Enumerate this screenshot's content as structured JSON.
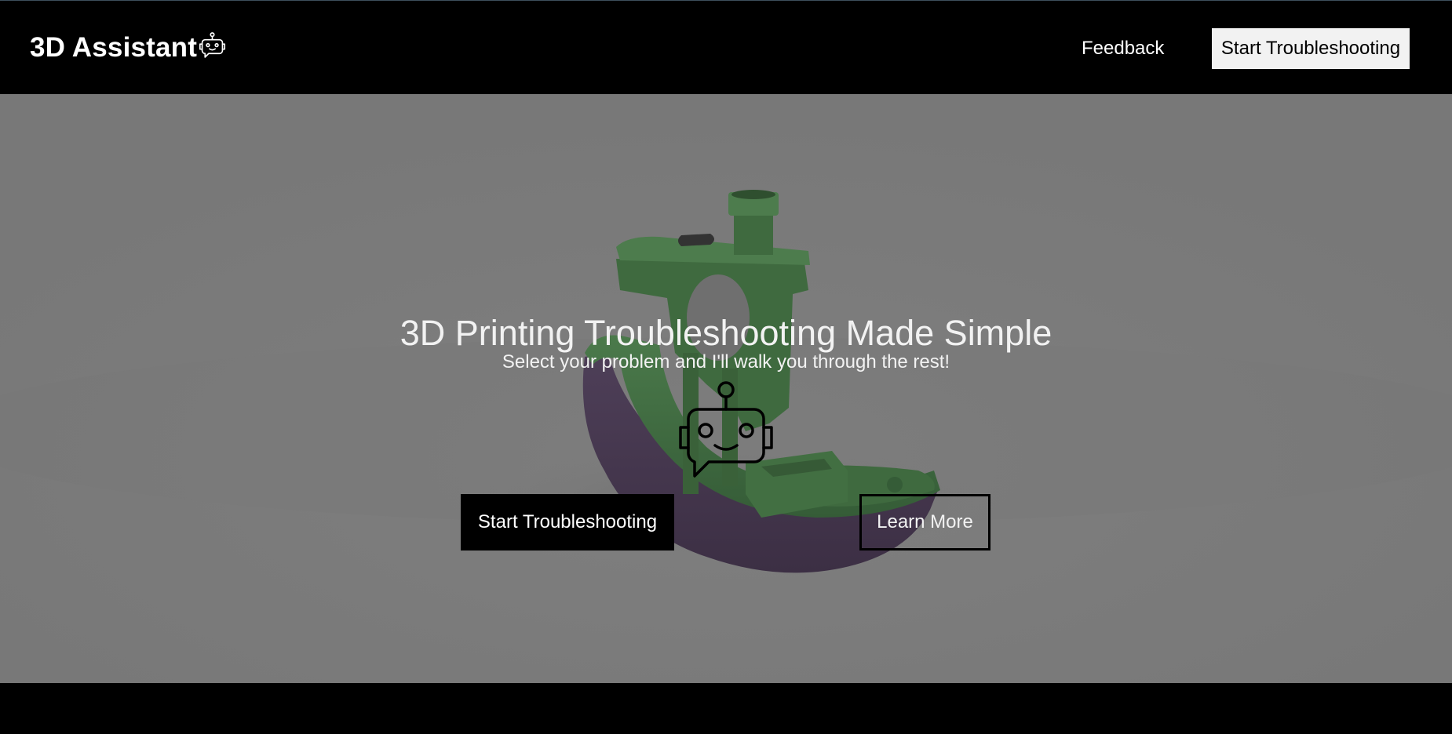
{
  "header": {
    "brand_text": "3D Assistant",
    "brand_icon": "robot-chat-icon",
    "nav_links": [
      {
        "label": "Feedback"
      }
    ],
    "cta_label": "Start Troubleshooting"
  },
  "hero": {
    "background_image": "green 3D printed boat model (dimmed)",
    "title": "3D Printing Troubleshooting Made Simple",
    "subtitle": "Select your problem and I'll walk you through the rest!",
    "robot_icon": "robot-chat-icon",
    "primary_button_label": "Start Troubleshooting",
    "secondary_button_label": "Learn More"
  },
  "colors": {
    "header_bg": "#000000",
    "hero_overlay": "#7a7a7a",
    "model_green": "#3f6a3f",
    "model_purple": "#4a3a52",
    "text_light": "#f2f2f2",
    "cta_bg": "#f2f2f2"
  }
}
